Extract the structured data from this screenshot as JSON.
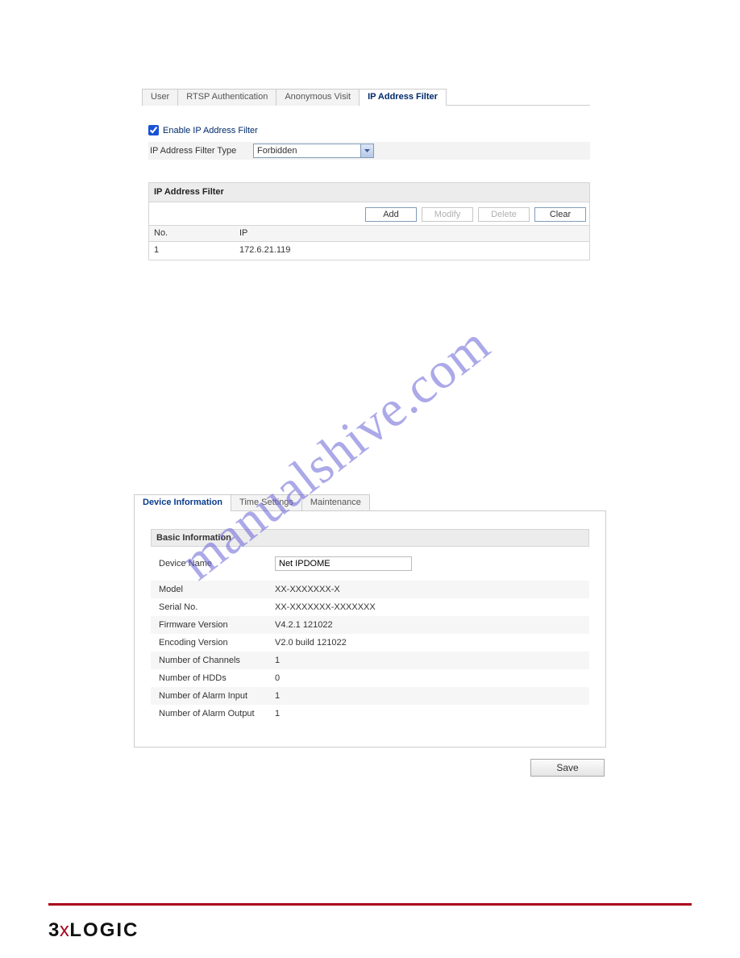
{
  "panel1": {
    "tabs": {
      "user": "User",
      "rtsp": "RTSP Authentication",
      "anon": "Anonymous Visit",
      "ipfilter": "IP Address Filter"
    },
    "enable_label": "Enable IP Address Filter",
    "filter_type_label": "IP Address Filter Type",
    "filter_type_value": "Forbidden",
    "section_title": "IP Address Filter",
    "buttons": {
      "add": "Add",
      "modify": "Modify",
      "delete": "Delete",
      "clear": "Clear"
    },
    "cols": {
      "no": "No.",
      "ip": "IP"
    },
    "rows": [
      {
        "no": "1",
        "ip": "172.6.21.119"
      }
    ]
  },
  "watermark_text": "manualshive.com",
  "panel2": {
    "tabs": {
      "device": "Device Information",
      "time": "Time Settings",
      "maint": "Maintenance"
    },
    "section_title": "Basic Information",
    "device_name_label": "Device Name",
    "device_name_value": "Net IPDOME",
    "rows": [
      {
        "label": "Model",
        "value": "XX-XXXXXXX-X"
      },
      {
        "label": "Serial No.",
        "value": "XX-XXXXXXX-XXXXXXX"
      },
      {
        "label": "Firmware Version",
        "value": "V4.2.1 121022"
      },
      {
        "label": "Encoding Version",
        "value": "V2.0 build 121022"
      },
      {
        "label": "Number of Channels",
        "value": "1"
      },
      {
        "label": "Number of HDDs",
        "value": "0"
      },
      {
        "label": "Number of Alarm Input",
        "value": "1"
      },
      {
        "label": "Number of Alarm Output",
        "value": "1"
      }
    ],
    "save_label": "Save"
  },
  "footer": {
    "three": "3",
    "x": "x",
    "logic": "LOGIC"
  }
}
